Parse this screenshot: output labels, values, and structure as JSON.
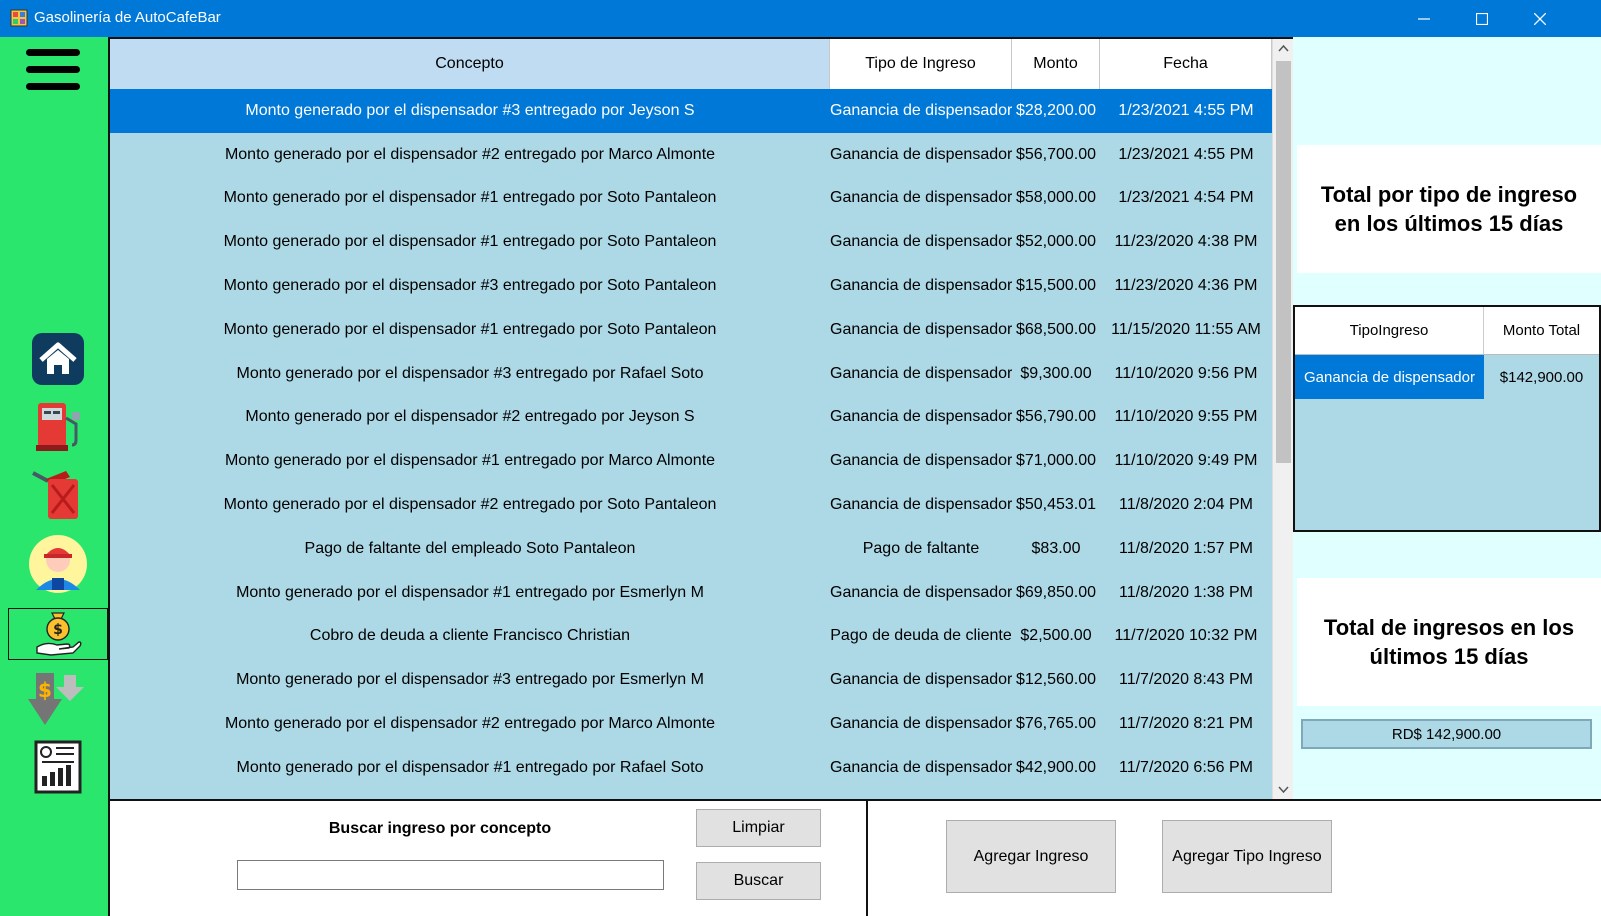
{
  "window": {
    "title": "Gasolinería de AutoCafeBar"
  },
  "sidebar": {
    "items": [
      {
        "icon": "home-icon"
      },
      {
        "icon": "fuel-pump-icon"
      },
      {
        "icon": "gas-can-icon"
      },
      {
        "icon": "employee-icon"
      },
      {
        "icon": "money-bag-hand-icon",
        "active": true
      },
      {
        "icon": "money-down-arrow-icon"
      },
      {
        "icon": "report-icon"
      }
    ]
  },
  "grid": {
    "columns": [
      "Concepto",
      "Tipo de Ingreso",
      "Monto",
      "Fecha"
    ],
    "rows": [
      {
        "concepto": "Monto generado por el dispensador #3 entregado por Jeyson S",
        "tipo": "Ganancia de dispensador",
        "monto": "$28,200.00",
        "fecha": "1/23/2021 4:55 PM",
        "selected": true
      },
      {
        "concepto": "Monto generado por el dispensador #2 entregado por Marco Almonte",
        "tipo": "Ganancia de dispensador",
        "monto": "$56,700.00",
        "fecha": "1/23/2021 4:55 PM"
      },
      {
        "concepto": "Monto generado por el dispensador #1 entregado por Soto Pantaleon",
        "tipo": "Ganancia de dispensador",
        "monto": "$58,000.00",
        "fecha": "1/23/2021 4:54 PM"
      },
      {
        "concepto": "Monto generado por el dispensador #1 entregado por Soto Pantaleon",
        "tipo": "Ganancia de dispensador",
        "monto": "$52,000.00",
        "fecha": "11/23/2020 4:38 PM"
      },
      {
        "concepto": "Monto generado por el dispensador #3 entregado por Soto Pantaleon",
        "tipo": "Ganancia de dispensador",
        "monto": "$15,500.00",
        "fecha": "11/23/2020 4:36 PM"
      },
      {
        "concepto": "Monto generado por el dispensador #1 entregado por Soto Pantaleon",
        "tipo": "Ganancia de dispensador",
        "monto": "$68,500.00",
        "fecha": "11/15/2020 11:55 AM"
      },
      {
        "concepto": "Monto generado por el dispensador #3 entregado por Rafael Soto",
        "tipo": "Ganancia de dispensador",
        "monto": "$9,300.00",
        "fecha": "11/10/2020 9:56 PM"
      },
      {
        "concepto": "Monto generado por el dispensador #2 entregado por Jeyson S",
        "tipo": "Ganancia de dispensador",
        "monto": "$56,790.00",
        "fecha": "11/10/2020 9:55 PM"
      },
      {
        "concepto": "Monto generado por el dispensador #1 entregado por Marco Almonte",
        "tipo": "Ganancia de dispensador",
        "monto": "$71,000.00",
        "fecha": "11/10/2020 9:49 PM"
      },
      {
        "concepto": "Monto generado por el dispensador #2 entregado por Soto Pantaleon",
        "tipo": "Ganancia de dispensador",
        "monto": "$50,453.01",
        "fecha": "11/8/2020 2:04 PM"
      },
      {
        "concepto": "Pago de faltante del empleado Soto Pantaleon",
        "tipo": "Pago de faltante",
        "monto": "$83.00",
        "fecha": "11/8/2020 1:57 PM"
      },
      {
        "concepto": "Monto generado por el dispensador #1 entregado por Esmerlyn M",
        "tipo": "Ganancia de dispensador",
        "monto": "$69,850.00",
        "fecha": "11/8/2020 1:38 PM"
      },
      {
        "concepto": "Cobro de deuda a cliente Francisco Christian",
        "tipo": "Pago de deuda de cliente",
        "monto": "$2,500.00",
        "fecha": "11/7/2020 10:32 PM"
      },
      {
        "concepto": "Monto generado por el dispensador #3 entregado por Esmerlyn M",
        "tipo": "Ganancia de dispensador",
        "monto": "$12,560.00",
        "fecha": "11/7/2020 8:43 PM"
      },
      {
        "concepto": "Monto generado por el dispensador #2 entregado por Marco Almonte",
        "tipo": "Ganancia de dispensador",
        "monto": "$76,765.00",
        "fecha": "11/7/2020 8:21 PM"
      },
      {
        "concepto": "Monto generado por el dispensador #1 entregado por Rafael Soto",
        "tipo": "Ganancia de dispensador",
        "monto": "$42,900.00",
        "fecha": "11/7/2020 6:56 PM"
      }
    ]
  },
  "summary": {
    "by_type_title": "Total por tipo de ingreso en los últimos 15 días",
    "by_type_columns": [
      "TipoIngreso",
      "Monto Total"
    ],
    "by_type_rows": [
      {
        "tipo": "Ganancia de dispensador",
        "total": "$142,900.00"
      }
    ],
    "total_title": "Total de ingresos en los últimos 15 días",
    "total_value": "RD$ 142,900.00"
  },
  "search": {
    "label": "Buscar ingreso por concepto",
    "value": "",
    "clear_label": "Limpiar",
    "search_label": "Buscar"
  },
  "actions": {
    "add_income_label": "Agregar Ingreso",
    "add_type_label": "Agregar Tipo Ingreso"
  },
  "colors": {
    "titlebar": "#0078d7",
    "sidebar": "#2ae66d",
    "grid_bg": "#add8e6",
    "selection": "#0078d7",
    "panel_bg": "#e0ffff"
  }
}
